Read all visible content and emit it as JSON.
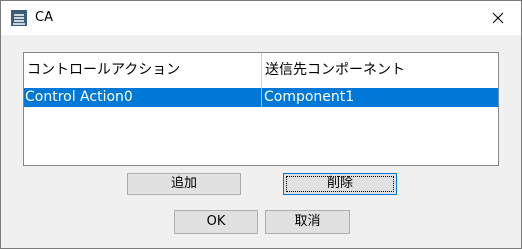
{
  "window": {
    "title": "CA",
    "app_icon": "rtc-app-icon",
    "close_icon": "close-icon"
  },
  "table": {
    "columns": [
      "コントロールアクション",
      "送信先コンポーネント"
    ],
    "rows": [
      {
        "action": "Control Action0",
        "component": "Component1",
        "selected": true
      }
    ]
  },
  "buttons": {
    "add": "追加",
    "delete": "削除",
    "ok": "OK",
    "cancel": "取消"
  },
  "colors": {
    "selection": "#0078d7",
    "dialog_bg": "#f0f0f0",
    "button_bg": "#e1e1e1"
  }
}
